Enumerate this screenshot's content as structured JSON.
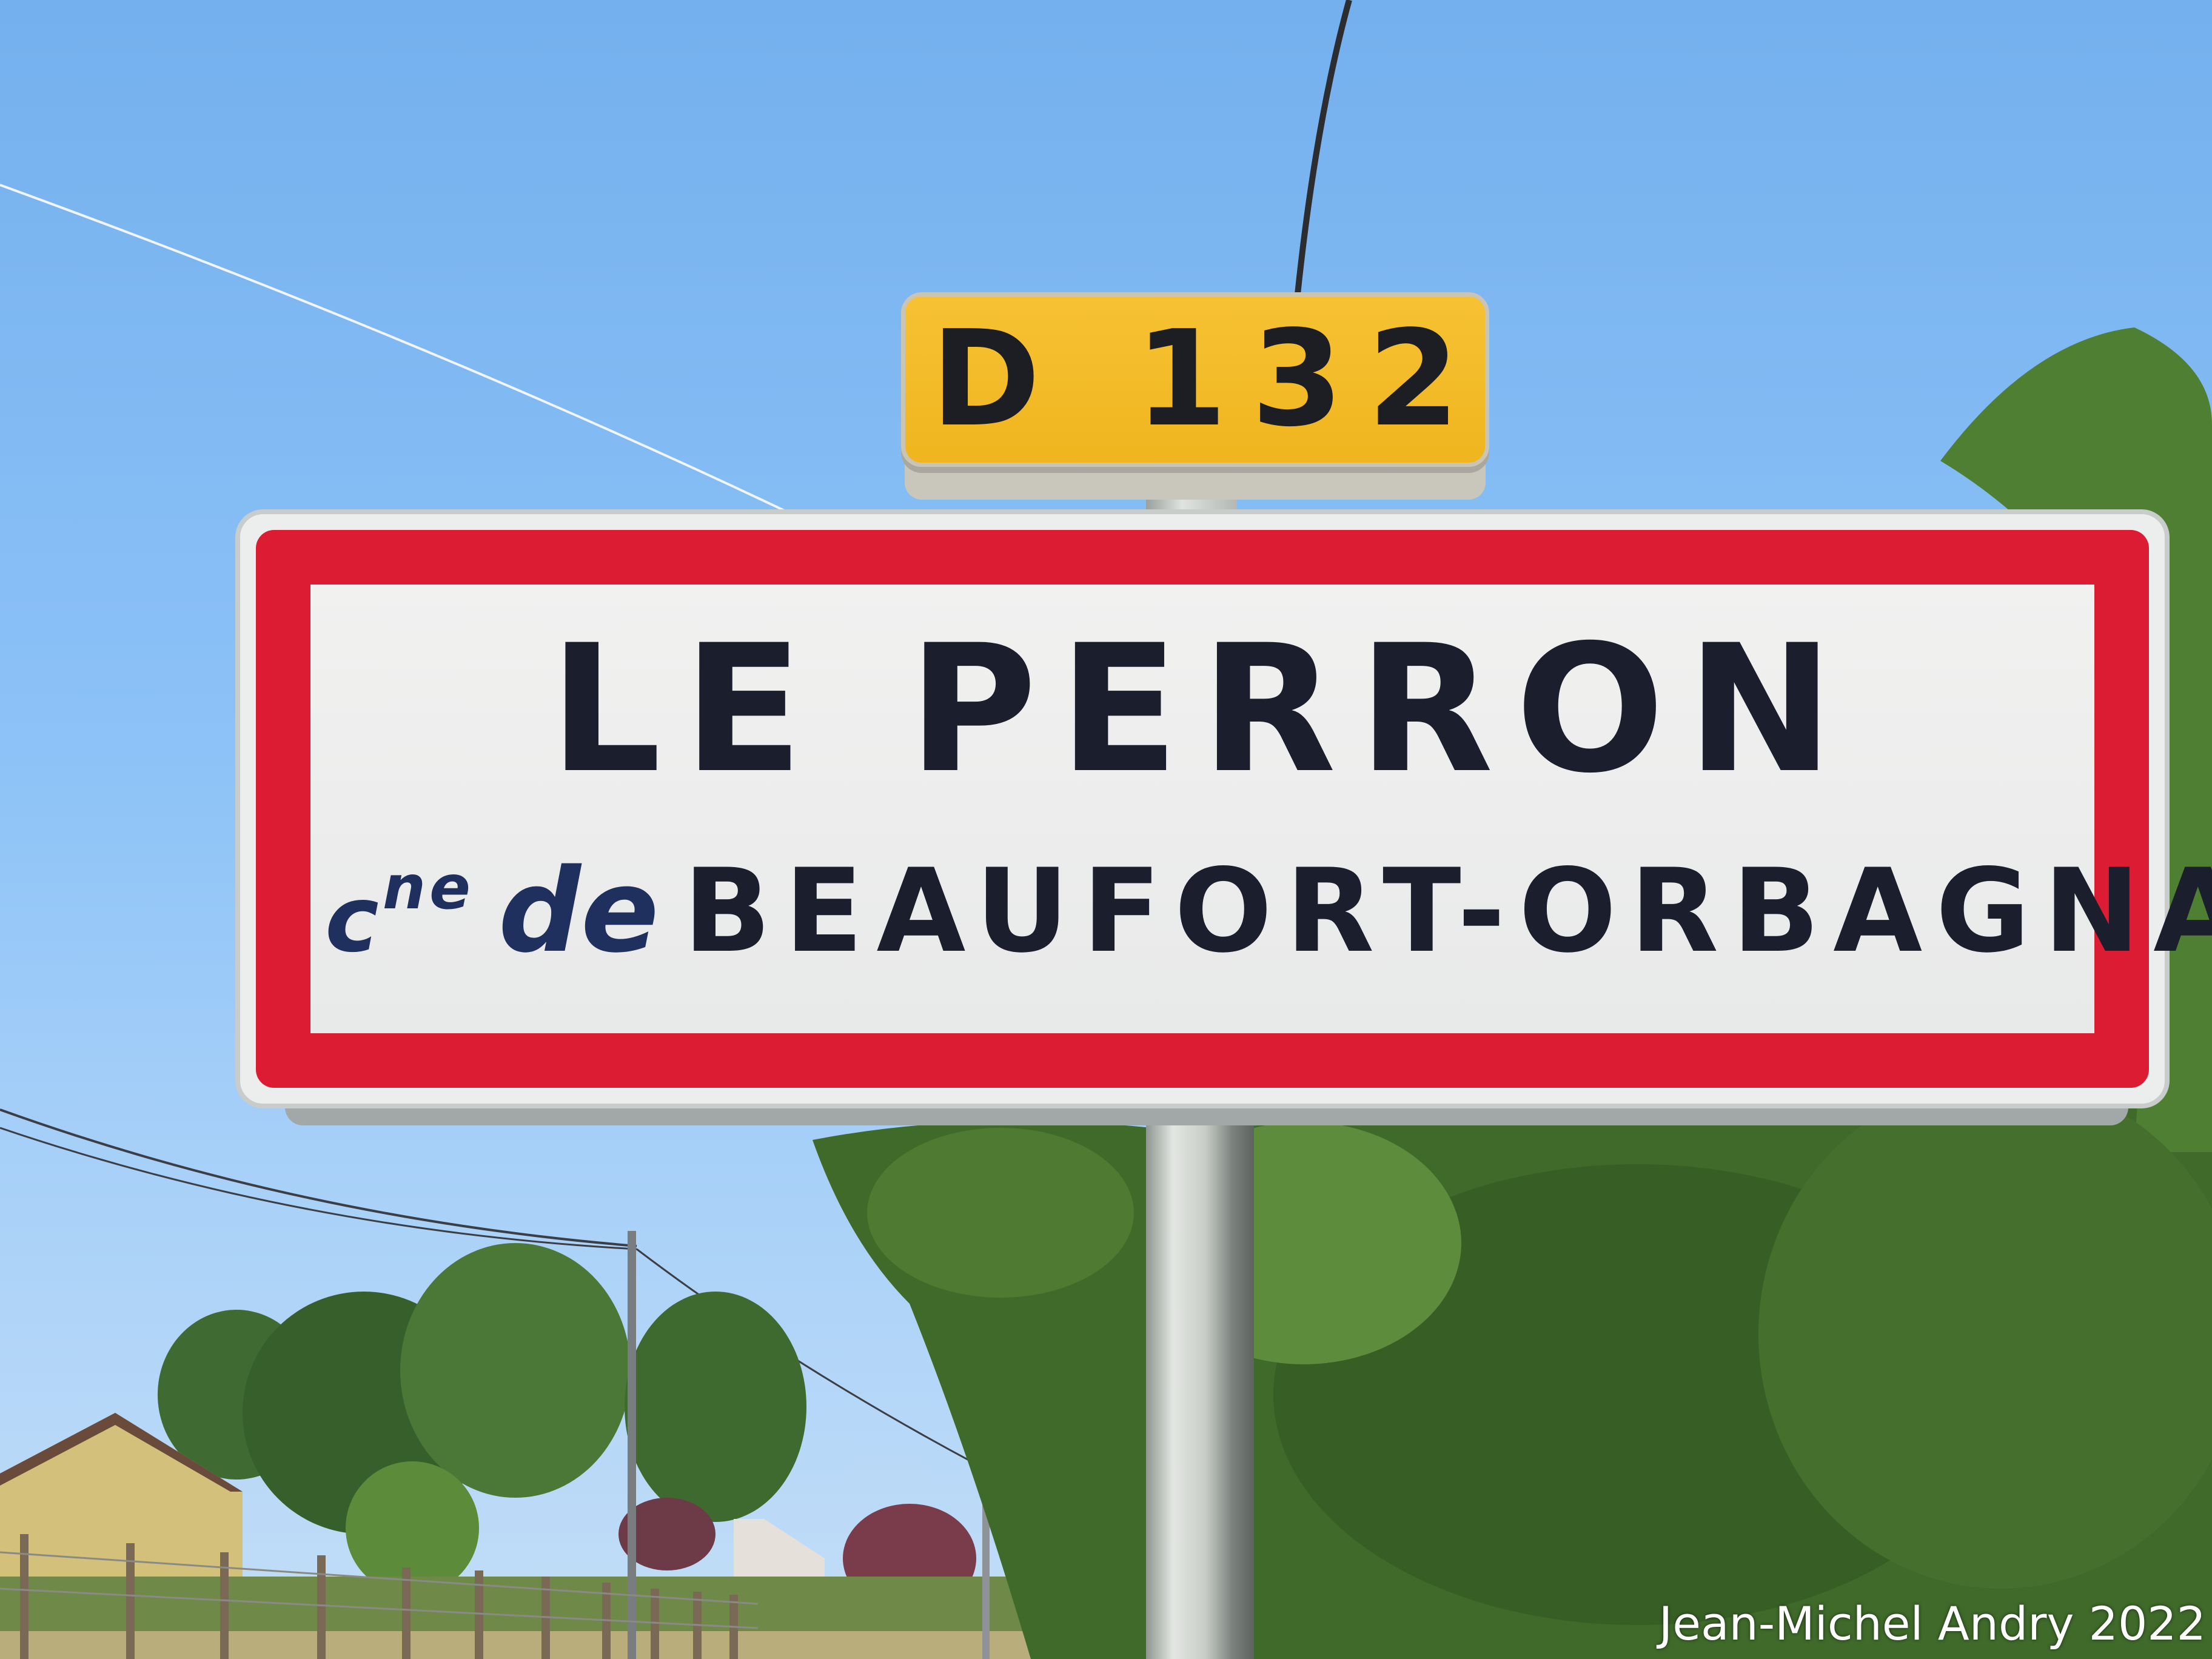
{
  "route_plate": {
    "text": "D 132",
    "color": "#f0b51f"
  },
  "entry_sign": {
    "town": "LE PERRON",
    "commune_prefix": "c",
    "commune_prefix_superscript": "ne",
    "commune_connector": "de",
    "commune": "BEAUFORT-ORBAGNA",
    "border_color": "#dc1c32"
  },
  "credit": "Jean-Michel Andry 2022",
  "colors": {
    "sky": "#86bdf4",
    "foliage": "#3f6a2a"
  }
}
